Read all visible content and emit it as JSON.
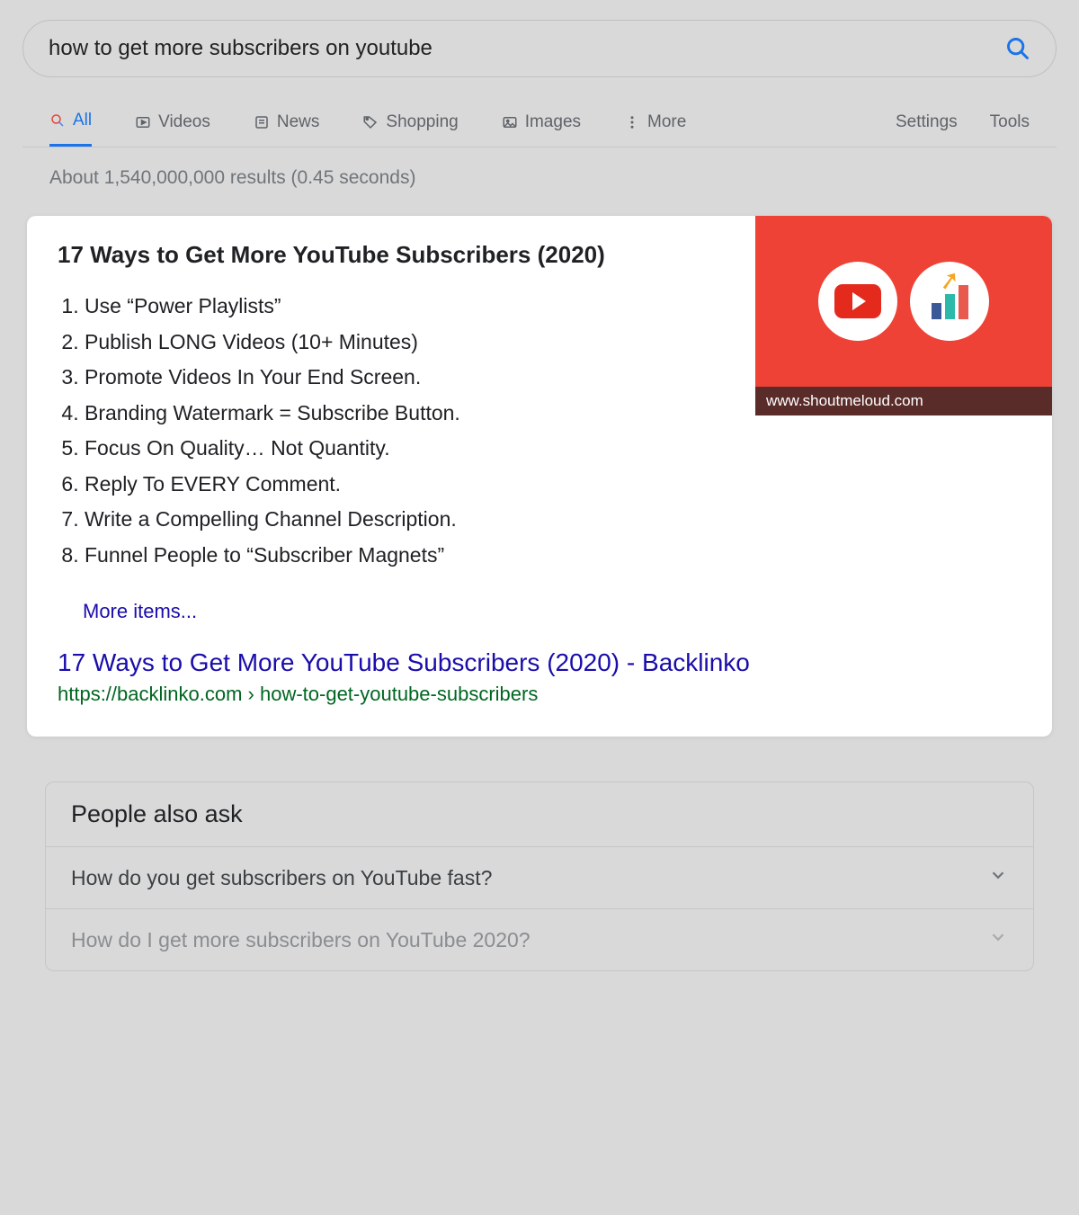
{
  "search": {
    "query": "how to get more subscribers on youtube"
  },
  "tabs": {
    "all": "All",
    "videos": "Videos",
    "news": "News",
    "shopping": "Shopping",
    "images": "Images",
    "more": "More",
    "settings": "Settings",
    "tools": "Tools"
  },
  "stats": "About 1,540,000,000 results (0.45 seconds)",
  "featured": {
    "heading": "17 Ways to Get More YouTube Subscribers (2020)",
    "items": [
      "Use “Power Playlists”",
      "Publish LONG Videos (10+ Minutes)",
      "Promote Videos In Your End Screen.",
      "Branding Watermark = Subscribe Button.",
      "Focus On Quality… Not Quantity.",
      "Reply To EVERY Comment.",
      "Write a Compelling Channel Description.",
      "Funnel People to “Subscriber Magnets”"
    ],
    "more_label": "More items...",
    "thumb_caption": "www.shoutmeloud.com",
    "link_title": "17 Ways to Get More YouTube Subscribers (2020) - Backlinko",
    "link_url": "https://backlinko.com › how-to-get-youtube-subscribers"
  },
  "paa": {
    "header": "People also ask",
    "q1": "How do you get subscribers on YouTube fast?",
    "q2": "How do I get more subscribers on YouTube 2020?"
  }
}
